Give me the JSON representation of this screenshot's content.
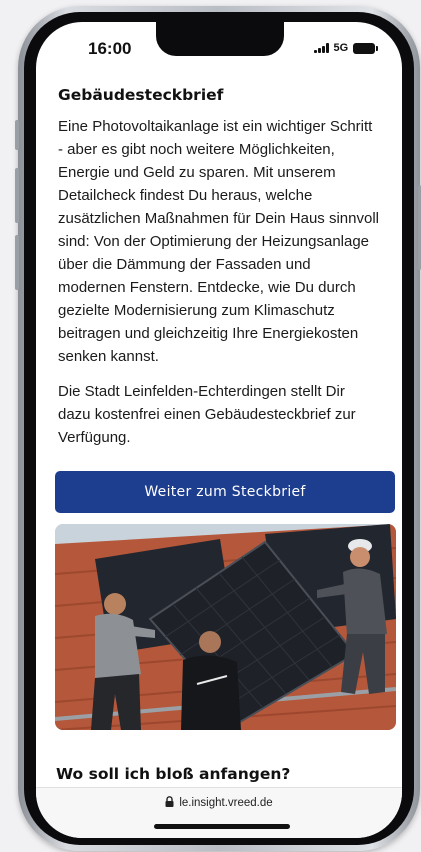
{
  "status_bar": {
    "time": "16:00",
    "network": "5G",
    "icons": [
      "signal-icon",
      "battery-icon"
    ]
  },
  "page": {
    "title": "Gebäudesteckbrief",
    "paragraph1": "Eine Photovoltaikanlage ist ein wichtiger Schritt - aber es gibt noch weitere Möglichkeiten, Energie und Geld zu sparen. Mit unserem Detailcheck findest Du heraus, welche zusätzlichen Maßnahmen für Dein Haus sinnvoll sind: Von der Optimierung der Heizungsanlage über die Dämmung der Fassaden und modernen Fenstern. Entdecke, wie Du durch gezielte Modernisierung zum Klimaschutz beitragen und gleichzeitig Ihre Energiekosten senken kannst.",
    "paragraph2": "Die Stadt Leinfelden-Echterdingen stellt Dir dazu kostenfrei einen Gebäudesteckbrief zur Verfügung.",
    "cta_label": "Weiter zum Steckbrief",
    "next_section_heading": "Wo soll ich bloß anfangen?"
  },
  "address_bar": {
    "url": "le.insight.vreed.de",
    "icon": "lock-icon"
  },
  "colors": {
    "cta_background": "#1d3d8f",
    "cta_text": "#ffffff",
    "roof_tiles": "#b5573a",
    "solar_panel": "#1e2128"
  }
}
